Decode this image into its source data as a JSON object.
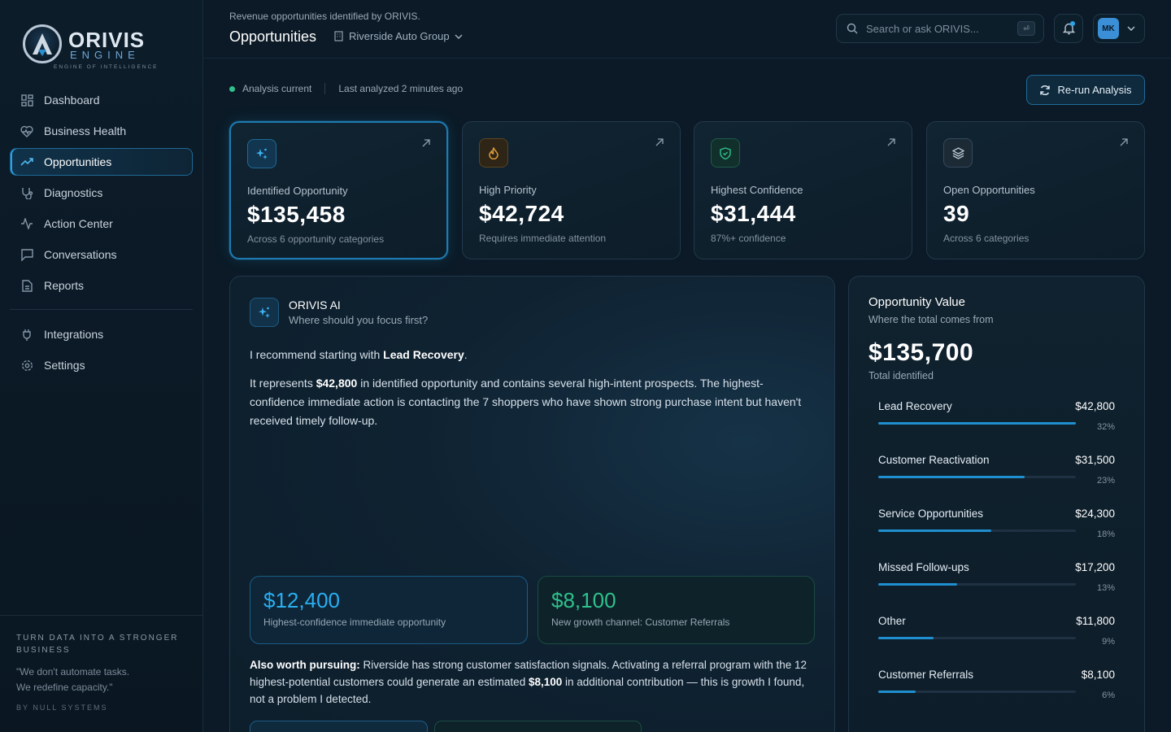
{
  "brand": {
    "name": "ORIVIS",
    "engine": "ENGINE",
    "tagline": "ENGINE OF INTELLIGENCE",
    "accent": "#29a3e6"
  },
  "sidebar": {
    "items": [
      {
        "label": "Dashboard",
        "icon": "grid-icon"
      },
      {
        "label": "Business Health",
        "icon": "heart-pulse-icon"
      },
      {
        "label": "Opportunities",
        "icon": "trending-up-icon",
        "active": true
      },
      {
        "label": "Diagnostics",
        "icon": "stethoscope-icon"
      },
      {
        "label": "Action Center",
        "icon": "activity-icon"
      },
      {
        "label": "Conversations",
        "icon": "chat-icon"
      },
      {
        "label": "Reports",
        "icon": "document-icon"
      }
    ],
    "secondary": [
      {
        "label": "Integrations",
        "icon": "plug-icon"
      },
      {
        "label": "Settings",
        "icon": "gear-icon"
      }
    ],
    "footer": {
      "title": "TURN DATA INTO A STRONGER BUSINESS",
      "quote_line1": "\"We don't automate tasks.",
      "quote_line2": "We redefine capacity.\"",
      "by": "BY NULL SYSTEMS"
    }
  },
  "header": {
    "subtitle": "Revenue opportunities identified by ORIVIS.",
    "title": "Opportunities",
    "org": "Riverside Auto Group",
    "search_placeholder": "Search or ask ORIVIS...",
    "kbd": "⏎",
    "user_initials": "MK"
  },
  "status": {
    "state": "Analysis current",
    "last": "Last analyzed 2 minutes ago",
    "rerun": "Re-run Analysis"
  },
  "kpis": [
    {
      "label": "Identified Opportunity",
      "value": "$135,458",
      "sub": "Across 6 opportunity categories",
      "icon": "sparkles-icon",
      "color": "#29a3e6"
    },
    {
      "label": "High Priority",
      "value": "$42,724",
      "sub": "Requires immediate attention",
      "icon": "flame-icon",
      "color": "#e8a33a"
    },
    {
      "label": "Highest Confidence",
      "value": "$31,444",
      "sub": "87%+ confidence",
      "icon": "shield-check-icon",
      "color": "#2fc18c"
    },
    {
      "label": "Open Opportunities",
      "value": "39",
      "sub": "Across 6 categories",
      "icon": "layers-icon",
      "color": "#9aa9b6"
    }
  ],
  "ai": {
    "name": "ORIVIS AI",
    "question": "Where should you focus first?",
    "p1_pre": "I recommend starting with ",
    "p1_bold": "Lead Recovery",
    "p1_post": ".",
    "p2_pre": "It represents ",
    "p2_bold": "$42,800",
    "p2_post": " in identified opportunity and contains several high-intent prospects. The highest-confidence immediate action is contacting the 7 shoppers who have shown strong purchase intent but haven't received timely follow-up.",
    "stat1_value": "$12,400",
    "stat1_sub": "Highest-confidence immediate opportunity",
    "stat2_value": "$8,100",
    "stat2_sub": "New growth channel: Customer Referrals",
    "p3_bold": "Also worth pursuing:",
    "p3_mid": " Riverside has strong customer satisfaction signals. Activating a referral program with the 12 highest-potential customers could generate an estimated ",
    "p3_bold2": "$8,100",
    "p3_post": " in additional contribution — this is growth I found, not a problem I detected."
  },
  "opportunity_value": {
    "title": "Opportunity Value",
    "subtitle": "Where the total comes from",
    "total": "$135,700",
    "total_label": "Total identified",
    "rows": [
      {
        "label": "Lead Recovery",
        "amount": "$42,800",
        "pct": "32%",
        "frac": 1.0
      },
      {
        "label": "Customer Reactivation",
        "amount": "$31,500",
        "pct": "23%",
        "frac": 0.74
      },
      {
        "label": "Service Opportunities",
        "amount": "$24,300",
        "pct": "18%",
        "frac": 0.57
      },
      {
        "label": "Missed Follow-ups",
        "amount": "$17,200",
        "pct": "13%",
        "frac": 0.4
      },
      {
        "label": "Other",
        "amount": "$11,800",
        "pct": "9%",
        "frac": 0.28
      },
      {
        "label": "Customer Referrals",
        "amount": "$8,100",
        "pct": "6%",
        "frac": 0.19
      }
    ]
  }
}
